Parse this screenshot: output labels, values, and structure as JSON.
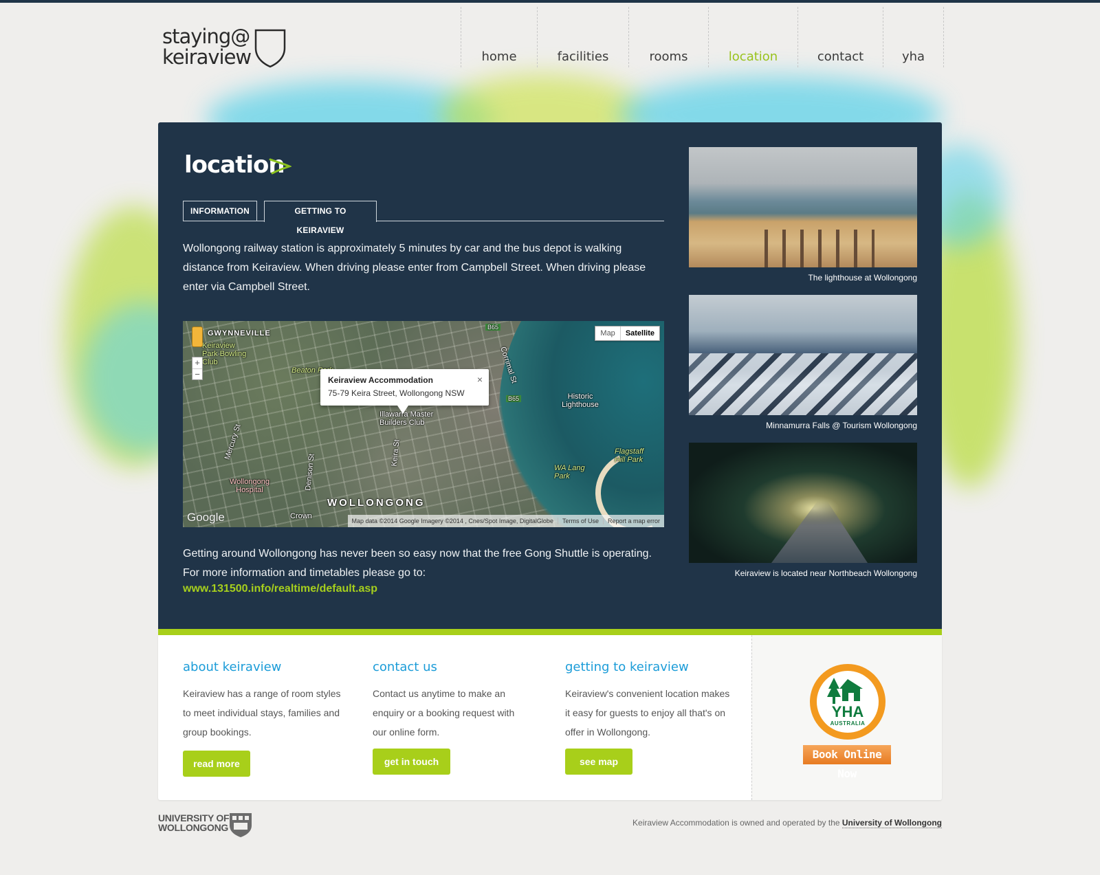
{
  "logo": {
    "line1": "staying@",
    "line2": "keiraview"
  },
  "nav": {
    "items": [
      {
        "label": "home",
        "active": false
      },
      {
        "label": "facilities",
        "active": false
      },
      {
        "label": "rooms",
        "active": false
      },
      {
        "label": "location",
        "active": true
      },
      {
        "label": "contact",
        "active": false
      },
      {
        "label": "yha",
        "active": false
      }
    ]
  },
  "main": {
    "title": "location",
    "tabs": [
      {
        "label": "INFORMATION",
        "selected": false
      },
      {
        "label": "GETTING TO KEIRAVIEW",
        "selected": true
      }
    ],
    "intro": "Wollongong railway station is approximately 5 minutes by car and the bus depot is walking distance from Keiraview. When driving please enter from Campbell Street. When driving please enter via Campbell Street.",
    "outro": "Getting around Wollongong has never been so easy now that the free Gong Shuttle is operating. For more information and timetables please go to:",
    "link": "www.131500.info/realtime/default.asp"
  },
  "map": {
    "toggle": {
      "map": "Map",
      "satellite": "Satellite",
      "selected": "Satellite"
    },
    "zoom_in": "+",
    "zoom_out": "−",
    "infowindow": {
      "title": "Keiraview Accommodation",
      "address": "75-79 Keira Street, Wollongong NSW",
      "close": "×"
    },
    "labels": {
      "gwynneville": "GWYNNEVILLE",
      "bowling": "Keiraview Park Bowling Club",
      "beaton": "Beaton Park",
      "illawarra": "Illawarra Master Builders Club",
      "lighthouse": "Historic Lighthouse",
      "flagstaff": "Flagstaff Hill Park",
      "walang": "WA Lang Park",
      "hospital": "Wollongong Hospital",
      "wollongong": "WOLLONGONG",
      "mercury": "Mercury St",
      "denison": "Denison St",
      "keira": "Keira St",
      "corrimal": "Corrimal St",
      "crown": "Crown",
      "b65": "B65",
      "b65b": "B65"
    },
    "google": "Google",
    "attribution": "Map data ©2014 Google Imagery ©2014 , Cnes/Spot Image, DigitalGlobe",
    "terms": "Terms of Use",
    "report": "Report a map error"
  },
  "gallery": [
    {
      "caption": "The lighthouse at Wollongong"
    },
    {
      "caption": "Minnamurra Falls @ Tourism Wollongong"
    },
    {
      "caption": "Keiraview is located near Northbeach Wollongong"
    }
  ],
  "footer": {
    "about": {
      "heading": "about keiraview",
      "text": "Keiraview has a range of room styles to meet individual stays, families and group bookings.",
      "button": "read more"
    },
    "contact": {
      "heading": "contact us",
      "text": "Contact us anytime to make an enquiry or a booking request with our online form.",
      "button": "get in touch"
    },
    "getting": {
      "heading": "getting to keiraview",
      "text": "Keiraview's convenient location makes it easy for guests to enjoy all that's on offer in Wollongong.",
      "button": "see map"
    },
    "yha": {
      "logo_text": "YHA",
      "logo_sub": "AUSTRALIA",
      "book": "Book Online Now"
    }
  },
  "bottom": {
    "uow_line1": "UNIVERSITY OF",
    "uow_line2": "WOLLONGONG",
    "owned_text": "Keiraview Accommodation is owned and operated by the",
    "owned_link": "University of Wollongong"
  },
  "colors": {
    "navy": "#203448",
    "accent_green": "#a8cf1a",
    "heading_blue": "#1b9cd8",
    "nav_active": "#99c21c"
  }
}
